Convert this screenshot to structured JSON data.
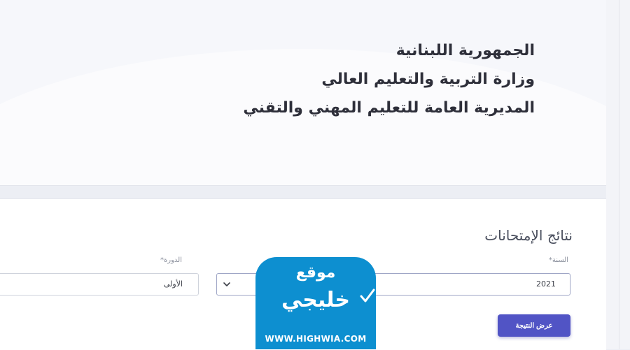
{
  "header": {
    "lines": [
      "الجمهورية اللبنانية",
      "وزارة التربية والتعليم العالي",
      "المديرية العامة للتعليم المهني والتقني"
    ]
  },
  "form": {
    "title": "نتائج الإمتحانات",
    "year": {
      "label": "السنة*",
      "value": "2021"
    },
    "session": {
      "label": "الدورة*",
      "value": "الأولى"
    },
    "submit_label": "عرض النتيجة"
  },
  "watermark": {
    "word1": "موقع",
    "word2": "خليجي",
    "url": "WWW.HIGHWIA.COM"
  },
  "colors": {
    "accent": "#5154c5",
    "watermark_blue": "#0d8fd0",
    "text_dark": "#2e2f3a"
  },
  "icons": {
    "select_arrow": "chevron-down-icon",
    "watermark_mark": "checkmark-icon"
  }
}
